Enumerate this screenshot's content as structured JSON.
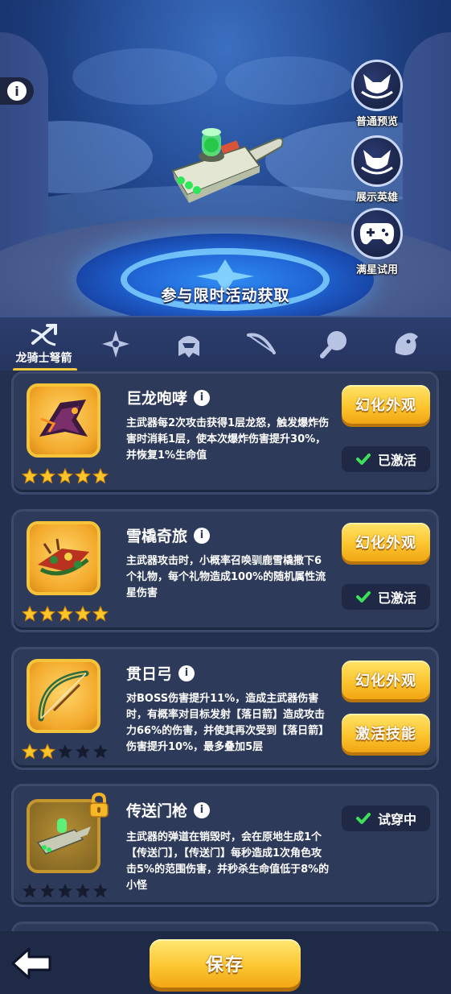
{
  "hero": {
    "caption": "参与限时活动获取",
    "side_buttons": [
      {
        "label": "普通预览",
        "icon": "fox-head-icon"
      },
      {
        "label": "展示英雄",
        "icon": "fox-head-icon"
      },
      {
        "label": "满星试用",
        "icon": "gamepad-icon"
      }
    ]
  },
  "tabs": [
    {
      "label": "龙骑士弩箭",
      "icon": "crossbow-icon",
      "active": true
    },
    {
      "label": "",
      "icon": "shuriken-icon",
      "active": false
    },
    {
      "label": "",
      "icon": "helmet-icon",
      "active": false
    },
    {
      "label": "",
      "icon": "bow-icon",
      "active": false
    },
    {
      "label": "",
      "icon": "ping-pong-icon",
      "active": false
    },
    {
      "label": "",
      "icon": "dragon-head-icon",
      "active": false
    }
  ],
  "skins": [
    {
      "name": "巨龙咆哮",
      "description": "主武器每2次攻击获得1层龙怒，触发爆炸伤害时消耗1层，使本次爆炸伤害提升30%，并恢复1%生命值",
      "stars": 5,
      "button": "幻化外观",
      "status": "已激活",
      "locked": false
    },
    {
      "name": "雪橇奇旅",
      "description": "主武器攻击时，小概率召唤驯鹿雪橇撒下6个礼物，每个礼物造成100%的随机属性流星伤害",
      "stars": 5,
      "button": "幻化外观",
      "status": "已激活",
      "locked": false
    },
    {
      "name": "贯日弓",
      "description": "对BOSS伤害提升11%，造成主武器伤害时，有概率对目标发射【落日箭】造成攻击力66%的伤害，并使其再次受到【落日箭】伤害提升10%，最多叠加5层",
      "stars": 2,
      "button": "幻化外观",
      "button2": "激活技能",
      "locked": false
    },
    {
      "name": "传送门枪",
      "description": "主武器的弹道在销毁时，会在原地生成1个【传送门】，【传送门】每秒造成1次角色攻击5%的范围伤害，并秒杀生命值低于8%的小怪",
      "stars": 0,
      "status": "试穿中",
      "locked": true
    }
  ],
  "bottom": {
    "save": "保存"
  }
}
